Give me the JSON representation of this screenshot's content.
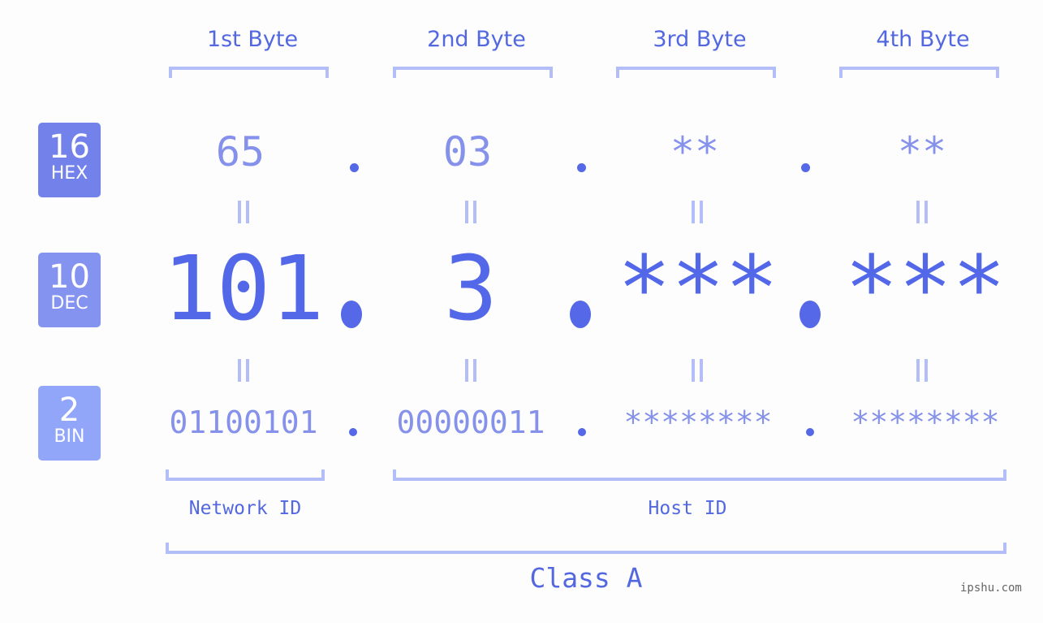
{
  "bytes": {
    "headers": [
      "1st Byte",
      "2nd Byte",
      "3rd Byte",
      "4th Byte"
    ],
    "hex": [
      "65",
      "03",
      "**",
      "**"
    ],
    "dec": [
      "101",
      "3",
      "***",
      "***"
    ],
    "bin": [
      "01100101",
      "00000011",
      "********",
      "********"
    ]
  },
  "badges": {
    "hex": {
      "number": "16",
      "label": "HEX",
      "color": "#7382ea"
    },
    "dec": {
      "number": "10",
      "label": "DEC",
      "color": "#8593f0"
    },
    "bin": {
      "number": "2",
      "label": "BIN",
      "color": "#91a6f8"
    }
  },
  "segments": {
    "network": "Network ID",
    "host": "Host ID",
    "class": "Class A"
  },
  "colors": {
    "accent": "#5368e8",
    "light_accent": "#8591ea",
    "bracket": "#b3bdf7"
  },
  "watermark": "ipshu.com"
}
